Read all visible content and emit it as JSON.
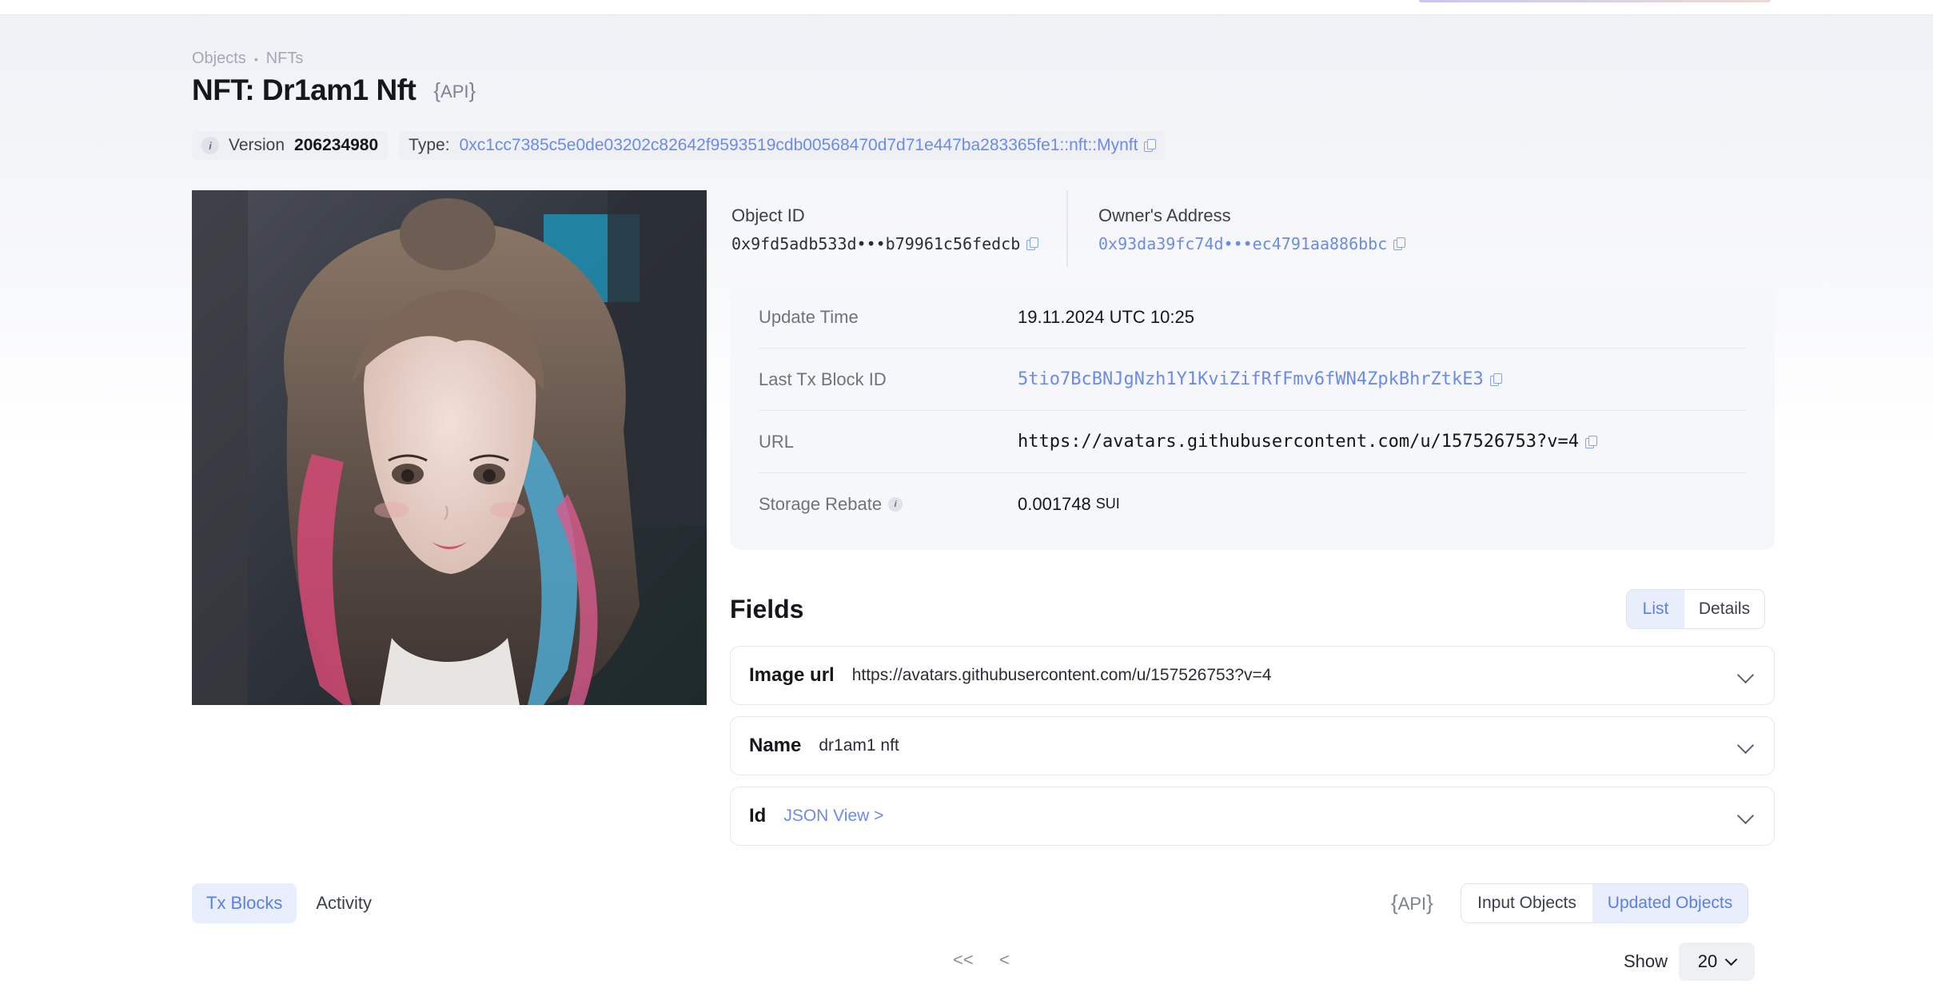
{
  "breadcrumb": [
    "Objects",
    "NFTs"
  ],
  "page_title": "NFT: Dr1am1 Nft",
  "api_label": "API",
  "version": {
    "label": "Version",
    "value": "206234980"
  },
  "type": {
    "label": "Type:",
    "value": "0xc1cc7385c5e0de03202c82642f9593519cdb00568470d7d71e447ba283365fe1::nft::Mynft"
  },
  "object_id": {
    "label": "Object ID",
    "value": "0x9fd5adb533d•••b79961c56fedcb"
  },
  "owner": {
    "label": "Owner's Address",
    "value": "0x93da39fc74d•••ec4791aa886bbc"
  },
  "details": {
    "update_time": {
      "label": "Update Time",
      "value": "19.11.2024 UTC 10:25"
    },
    "last_tx": {
      "label": "Last Tx Block ID",
      "value": "5tio7BcBNJgNzh1Y1KviZifRfFmv6fWN4ZpkBhrZtkE3"
    },
    "url": {
      "label": "URL",
      "value": "https://avatars.githubusercontent.com/u/157526753?v=4"
    },
    "storage_rebate": {
      "label": "Storage Rebate",
      "value": "0.001748",
      "unit": "SUI"
    }
  },
  "fields": {
    "title": "Fields",
    "view_toggle": [
      "List",
      "Details"
    ],
    "active_view": "List",
    "rows": [
      {
        "name": "Image url",
        "value": "https://avatars.githubusercontent.com/u/157526753?v=4"
      },
      {
        "name": "Name",
        "value": "dr1am1 nft"
      },
      {
        "name": "Id",
        "value": "JSON View >"
      }
    ]
  },
  "tabs": [
    "Tx Blocks",
    "Activity"
  ],
  "active_tab": "Tx Blocks",
  "object_filter": [
    "Input Objects",
    "Updated Objects"
  ],
  "active_filter": "Updated Objects",
  "pagination": {
    "first": "<<",
    "prev": "<",
    "show_label": "Show",
    "page_size": "20"
  },
  "colors": {
    "accent": "#6c8be8",
    "active_bg": "#e8eefc",
    "card_bg": "#f6f7fb"
  },
  "image": "anime-style portrait (dark hair with blue and pink streaks)"
}
